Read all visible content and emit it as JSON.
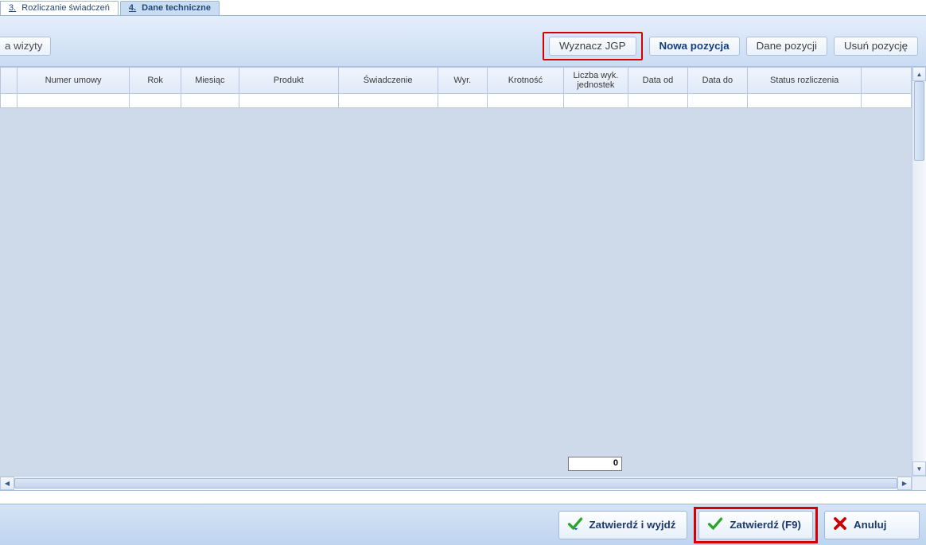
{
  "tabs": {
    "t3_num": "3.",
    "t3_label": "Rozliczanie świadczeń",
    "t4_num": "4.",
    "t4_label": "Dane techniczne"
  },
  "toolbar": {
    "wizyty": "a wizyty",
    "wyznacz": "Wyznacz JGP",
    "nowa": "Nowa pozycja",
    "dane": "Dane pozycji",
    "usun": "Usuń pozycję"
  },
  "columns": {
    "numer": "Numer umowy",
    "rok": "Rok",
    "miesiac": "Miesiąc",
    "produkt": "Produkt",
    "swiadczenie": "Świadczenie",
    "wyr": "Wyr.",
    "krotnosc": "Krotność",
    "liczba": "Liczba wyk. jednostek",
    "dataod": "Data od",
    "datado": "Data do",
    "status": "Status rozliczenia"
  },
  "summary_value": "0",
  "footer": {
    "zatwierdz_wyjdz": "Zatwierdź i wyjdź",
    "zatwierdz": "Zatwierdź (F9)",
    "anuluj": "Anuluj"
  }
}
